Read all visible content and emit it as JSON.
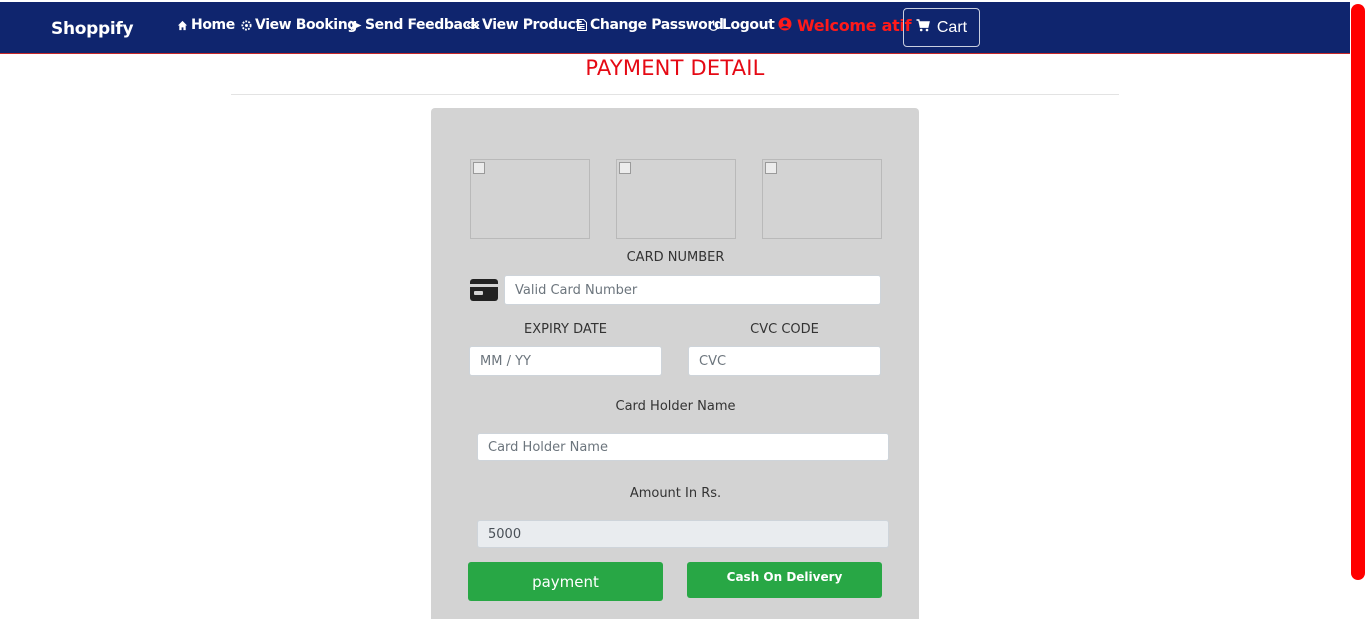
{
  "navbar": {
    "brand": "Shoppify",
    "items": [
      {
        "label": "Home",
        "icon": "home-icon"
      },
      {
        "label": "View Booking",
        "icon": "gear-icon"
      },
      {
        "label": "Send Feedback",
        "icon": "send-icon"
      },
      {
        "label": "View Product",
        "icon": "eye-icon"
      },
      {
        "label": "Change Password",
        "icon": "document-icon"
      },
      {
        "label": "Logout",
        "icon": "power-icon"
      }
    ],
    "welcome": "Welcome atif",
    "cart_label": "Cart"
  },
  "page": {
    "title": "PAYMENT DETAIL"
  },
  "form": {
    "card_number_label": "CARD NUMBER",
    "card_number_placeholder": "Valid Card Number",
    "expiry_label": "EXPIRY DATE",
    "expiry_placeholder": "MM / YY",
    "cvc_label": "CVC CODE",
    "cvc_placeholder": "CVC",
    "holder_label": "Card Holder Name",
    "holder_placeholder": "Card Holder Name",
    "amount_label": "Amount In Rs.",
    "amount_value": "5000",
    "payment_button": "payment",
    "cod_button": "Cash On Delivery"
  },
  "colors": {
    "navbar_bg": "#0f256e",
    "title_red": "#e50914",
    "welcome_red": "#ff1a1a",
    "button_green": "#28a745",
    "panel_bg": "#d3d3d3",
    "scrollbar": "#ff0000"
  }
}
